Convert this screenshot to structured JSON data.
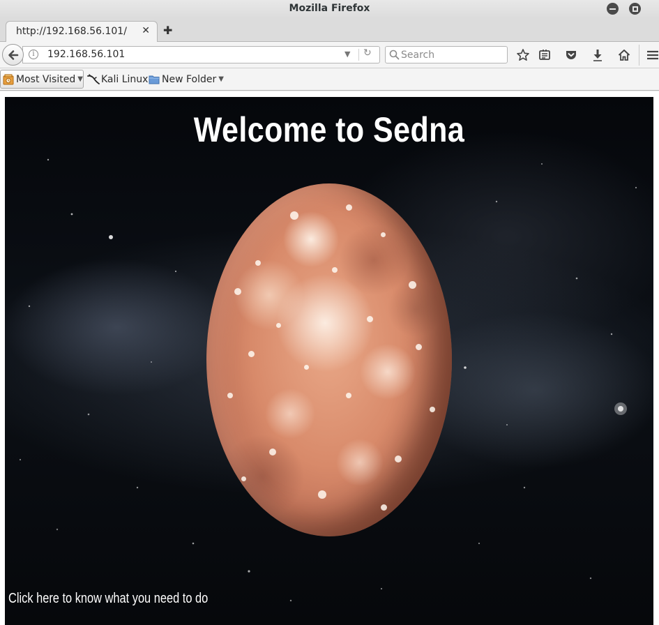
{
  "window": {
    "title": "Mozilla Firefox"
  },
  "tabs": [
    {
      "label": "http://192.168.56.101/",
      "active": true
    }
  ],
  "navbar": {
    "url": "192.168.56.101",
    "search_placeholder": "Search"
  },
  "bookmarks": {
    "items": [
      {
        "label": "Most Visited",
        "icon": "most-visited-icon",
        "has_dropdown": true
      },
      {
        "label": "Kali Linux",
        "icon": "kali-dragon-icon",
        "has_dropdown": false
      },
      {
        "label": "New Folder",
        "icon": "folder-icon",
        "has_dropdown": true
      }
    ]
  },
  "page": {
    "heading": "Welcome to Sedna",
    "cta_link": "Click here to know what you need to do",
    "background": "space-starfield",
    "image_subject": "Sedna planet"
  },
  "colors": {
    "chrome_bg": "#f4f4f4",
    "page_text": "#ffffff",
    "planet_base": "#d88a6a"
  }
}
